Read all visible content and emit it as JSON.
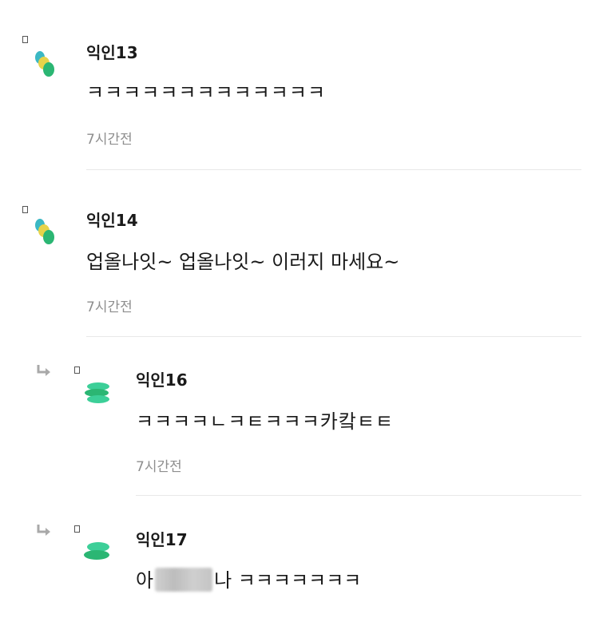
{
  "comments": [
    {
      "author": "익인13",
      "text": "ㅋㅋㅋㅋㅋㅋㅋㅋㅋㅋㅋㅋㅋ",
      "time": "7시간전",
      "reply": false,
      "avatar": "multi-dot-avatar"
    },
    {
      "author": "익인14",
      "text": "업올나잇~ 업올나잇~ 이러지 마세요~",
      "time": "7시간전",
      "reply": false,
      "avatar": "multi-dot-avatar"
    },
    {
      "author": "익인16",
      "text": "ㅋㅋㅋㅋㄴㅋㅌㅋㅋㅋ카캌ㅌㅌ",
      "time": "7시간전",
      "reply": true,
      "avatar": "green-stack-avatar"
    },
    {
      "author": "익인17",
      "text_prefix": "아",
      "text_suffix": "나 ㅋㅋㅋㅋㅋㅋㅋ",
      "reply": true,
      "avatar": "green-stack-avatar"
    }
  ],
  "colors": {
    "teal": "#3bb8c4",
    "yellow": "#e7d34a",
    "green": "#2bb673",
    "mint": "#3ccf98",
    "timestamp": "#8e8e8e",
    "divider": "#e8e8e8"
  },
  "icons": {
    "reply": "reply-arrow-icon",
    "badge": "small-badge-icon"
  }
}
